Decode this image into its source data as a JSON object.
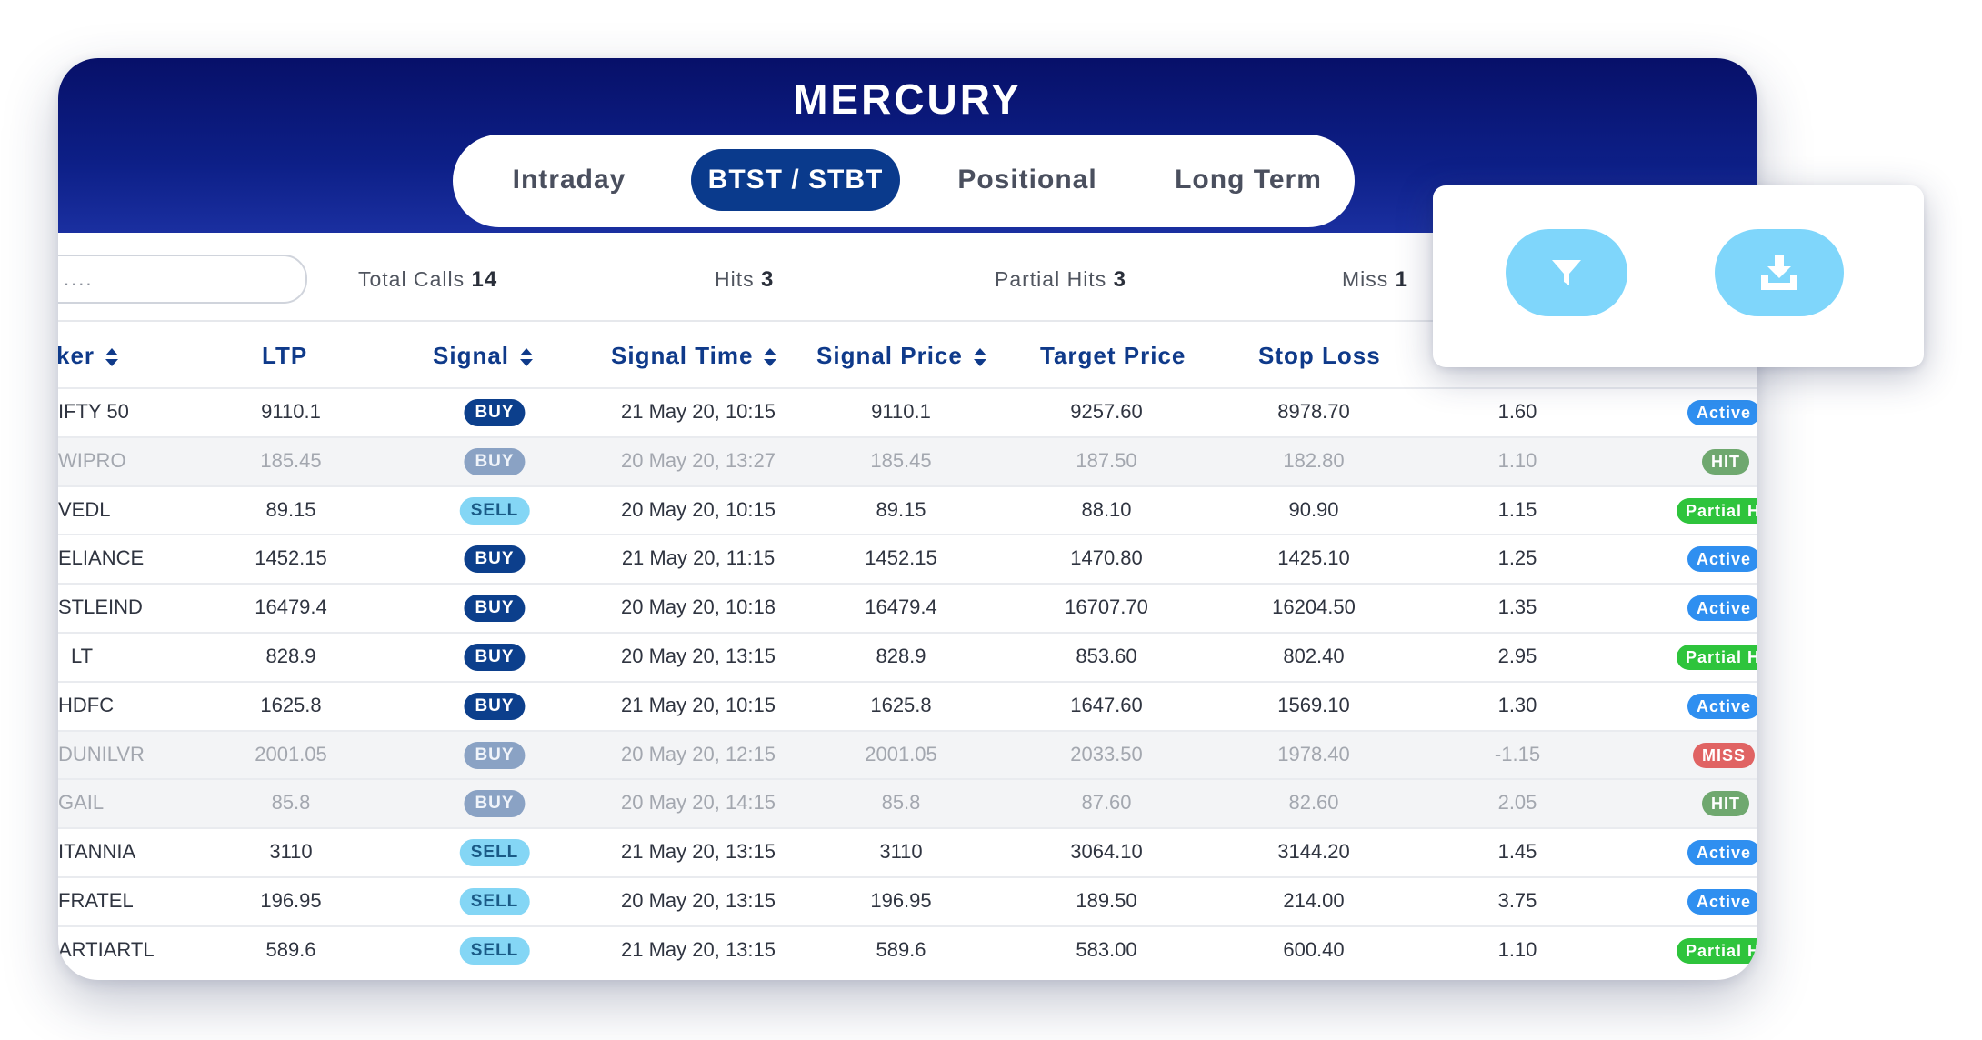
{
  "app": {
    "title": "MERCURY"
  },
  "tabs": [
    {
      "label": "Intraday",
      "active": false
    },
    {
      "label": "BTST / STBT",
      "active": true
    },
    {
      "label": "Positional",
      "active": false
    },
    {
      "label": "Long Term",
      "active": false
    }
  ],
  "search": {
    "placeholder": "...."
  },
  "stats": {
    "total_calls_label": "Total Calls",
    "total_calls": "14",
    "hits_label": "Hits",
    "hits": "3",
    "partial_hits_label": "Partial Hits",
    "partial_hits": "3",
    "miss_label": "Miss",
    "miss": "1"
  },
  "columns": {
    "ticker": "ker",
    "ltp": "LTP",
    "signal": "Signal",
    "signal_time": "Signal Time",
    "signal_price": "Signal Price",
    "target_price": "Target Price",
    "stop_loss": "Stop Loss"
  },
  "rows": [
    {
      "ticker": "IFTY 50",
      "ltp": "9110.1",
      "signal": "BUY",
      "time": "21 May 20, 10:15",
      "price": "9110.1",
      "target": "9257.60",
      "stop": "8978.70",
      "ratio": "1.60",
      "status": "Active"
    },
    {
      "ticker": "WIPRO",
      "ltp": "185.45",
      "signal": "BUY",
      "time": "20 May 20, 13:27",
      "price": "185.45",
      "target": "187.50",
      "stop": "182.80",
      "ratio": "1.10",
      "status": "HIT"
    },
    {
      "ticker": "VEDL",
      "ltp": "89.15",
      "signal": "SELL",
      "time": "20 May 20, 10:15",
      "price": "89.15",
      "target": "88.10",
      "stop": "90.90",
      "ratio": "1.15",
      "status": "Partial Hi"
    },
    {
      "ticker": "ELIANCE",
      "ltp": "1452.15",
      "signal": "BUY",
      "time": "21 May 20, 11:15",
      "price": "1452.15",
      "target": "1470.80",
      "stop": "1425.10",
      "ratio": "1.25",
      "status": "Active"
    },
    {
      "ticker": "STLEIND",
      "ltp": "16479.4",
      "signal": "BUY",
      "time": "20 May 20, 10:18",
      "price": "16479.4",
      "target": "16707.70",
      "stop": "16204.50",
      "ratio": "1.35",
      "status": "Active"
    },
    {
      "ticker": "LT",
      "ltp": "828.9",
      "signal": "BUY",
      "time": "20 May 20, 13:15",
      "price": "828.9",
      "target": "853.60",
      "stop": "802.40",
      "ratio": "2.95",
      "status": "Partial Hi"
    },
    {
      "ticker": "HDFC",
      "ltp": "1625.8",
      "signal": "BUY",
      "time": "21 May 20, 10:15",
      "price": "1625.8",
      "target": "1647.60",
      "stop": "1569.10",
      "ratio": "1.30",
      "status": "Active"
    },
    {
      "ticker": "DUNILVR",
      "ltp": "2001.05",
      "signal": "BUY",
      "time": "20 May 20, 12:15",
      "price": "2001.05",
      "target": "2033.50",
      "stop": "1978.40",
      "ratio": "-1.15",
      "status": "MISS"
    },
    {
      "ticker": "GAIL",
      "ltp": "85.8",
      "signal": "BUY",
      "time": "20 May 20, 14:15",
      "price": "85.8",
      "target": "87.60",
      "stop": "82.60",
      "ratio": "2.05",
      "status": "HIT"
    },
    {
      "ticker": "ITANNIA",
      "ltp": "3110",
      "signal": "SELL",
      "time": "21 May 20, 13:15",
      "price": "3110",
      "target": "3064.10",
      "stop": "3144.20",
      "ratio": "1.45",
      "status": "Active"
    },
    {
      "ticker": "FRATEL",
      "ltp": "196.95",
      "signal": "SELL",
      "time": "20 May 20, 13:15",
      "price": "196.95",
      "target": "189.50",
      "stop": "214.00",
      "ratio": "3.75",
      "status": "Active"
    },
    {
      "ticker": "ARTIARTL",
      "ltp": "589.6",
      "signal": "SELL",
      "time": "21 May 20, 13:15",
      "price": "589.6",
      "target": "583.00",
      "stop": "600.40",
      "ratio": "1.10",
      "status": "Partial Hi"
    }
  ],
  "popup": {
    "filter_icon": "filter-icon",
    "download_icon": "download-icon"
  },
  "colors": {
    "header": "#071069",
    "accent": "#0a3a8c",
    "fab": "#7fd6fb",
    "active": "#2f8ff0",
    "hit": "#6fa86f",
    "partial": "#2ec43c",
    "miss": "#e06363"
  }
}
